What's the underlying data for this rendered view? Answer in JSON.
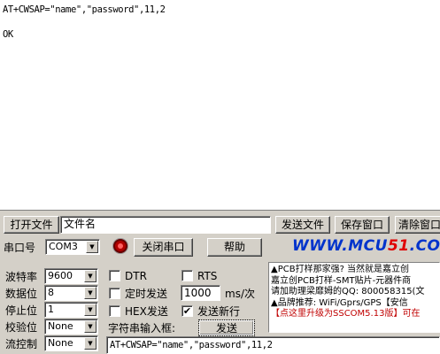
{
  "output": {
    "lines": [
      "AT+CWSAP=\"name\",\"password\",11,2",
      "",
      "OK"
    ]
  },
  "file_row": {
    "open_file": "打开文件",
    "file_name": "文件名",
    "send_file": "发送文件",
    "save_window": "保存窗口",
    "clear_window": "清除窗口"
  },
  "port_row": {
    "port_label": "串口号",
    "port_value": "COM3",
    "close_port": "关闭串口",
    "help": "帮助"
  },
  "logo": {
    "prefix": "WWW.",
    "brand": "MCU",
    "num": "51",
    "suffix": ".COM"
  },
  "settings": {
    "baud_label": "波特率",
    "baud_value": "9600",
    "data_label": "数据位",
    "data_value": "8",
    "stop_label": "停止位",
    "stop_value": "1",
    "parity_label": "校验位",
    "parity_value": "None",
    "flow_label": "流控制",
    "flow_value": "None"
  },
  "options": {
    "dtr": "DTR",
    "rts": "RTS",
    "timed_send": "定时发送",
    "interval_value": "1000",
    "interval_unit": "ms/次",
    "hex_send": "HEX发送",
    "send_newline": "发送新行",
    "send_newline_checked": "✔",
    "input_label": "字符串输入框:",
    "send_button": "发送",
    "input_value": "AT+CWSAP=\"name\",\"password\",11,2"
  },
  "ad": {
    "lines": [
      "▲PCB打样那家强? 当然就是嘉立创",
      "嘉立创PCB打样-SMT贴片-元器件商",
      "请加助理梁靡姆的QQ: 800058315(文",
      "▲品牌推荐: WiFi/Gprs/GPS【安信",
      "【点这里升级为SSCOM5.13版】可在"
    ]
  }
}
